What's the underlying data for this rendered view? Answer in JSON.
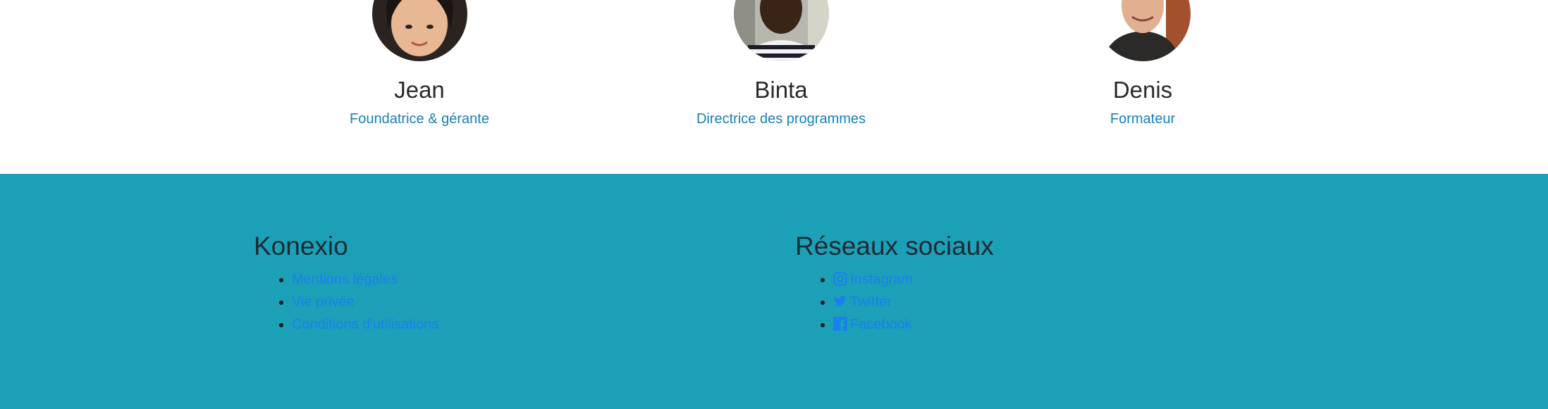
{
  "team": [
    {
      "name": "Jean",
      "role": "Foundatrice & gérante"
    },
    {
      "name": "Binta",
      "role": "Directrice des programmes"
    },
    {
      "name": "Denis",
      "role": "Formateur"
    }
  ],
  "footer": {
    "col1": {
      "title": "Konexio",
      "links": [
        "Mentions légales",
        "Vie privée",
        "Conditions d'utilisations"
      ]
    },
    "col2": {
      "title": "Réseaux sociaux",
      "links": [
        {
          "label": "Instagram",
          "icon": "instagram-icon"
        },
        {
          "label": "Twitter",
          "icon": "twitter-icon"
        },
        {
          "label": "Facebook",
          "icon": "facebook-icon"
        }
      ]
    }
  },
  "colors": {
    "footer_bg": "#1ca0b8",
    "link": "#1a7ff0",
    "role": "#1a7fb8"
  }
}
